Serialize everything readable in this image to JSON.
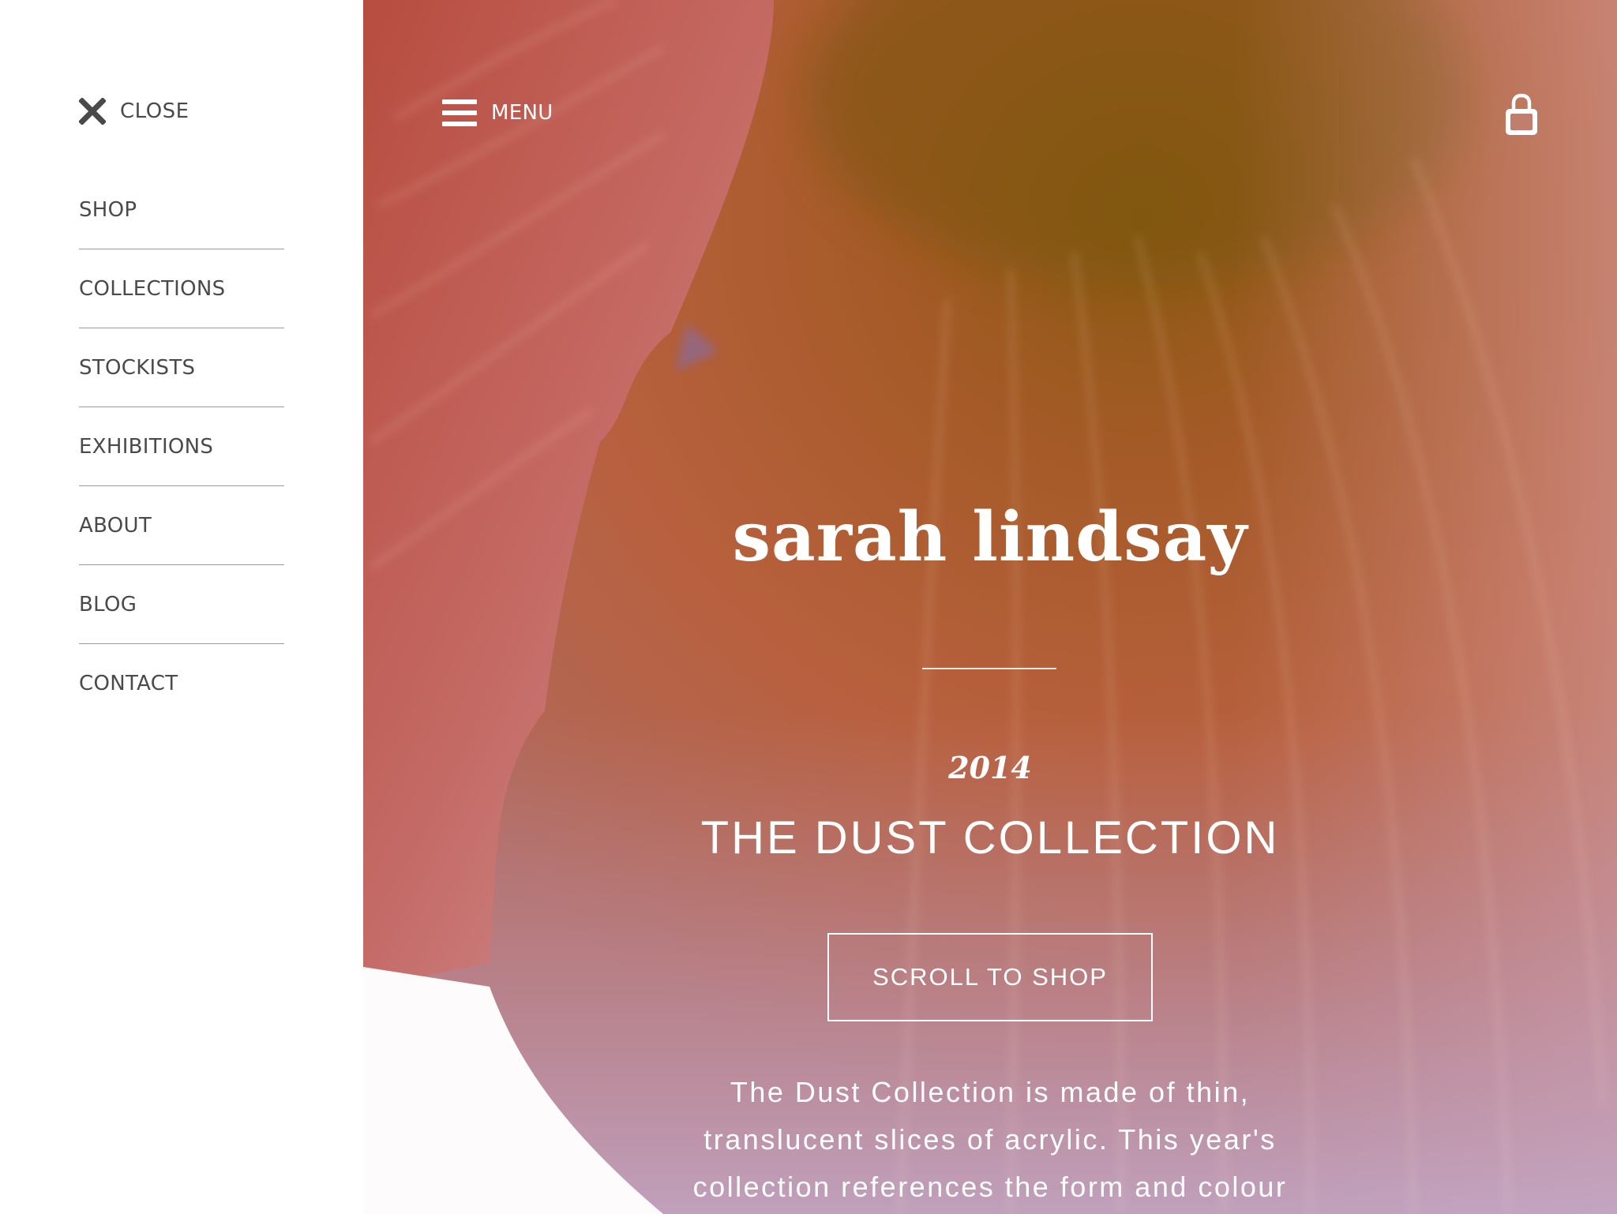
{
  "drawer": {
    "close_label": "CLOSE",
    "close_icon": "close-icon",
    "nav_items": [
      {
        "label": "SHOP"
      },
      {
        "label": "COLLECTIONS"
      },
      {
        "label": "STOCKISTS"
      },
      {
        "label": "EXHIBITIONS"
      },
      {
        "label": "ABOUT"
      },
      {
        "label": "BLOG"
      },
      {
        "label": "CONTACT"
      }
    ]
  },
  "header": {
    "menu_label": "MENU",
    "menu_icon": "hamburger-icon",
    "cart_icon": "shopping-bag-icon"
  },
  "hero": {
    "brand": "sarah lindsay",
    "year": "2014",
    "collection_title": "THE DUST COLLECTION",
    "cta_label": "SCROLL TO SHOP",
    "description_lines": [
      "The Dust Collection is made of thin,",
      "translucent slices of acrylic. This year's",
      "collection references the form and colour"
    ]
  },
  "colors": {
    "text_dark": "#4a4a4a",
    "divider": "#9a9a9a",
    "hero_text": "#ffffff",
    "petal_red": "#c25a4a",
    "petal_orange": "#b0602a",
    "petal_pink": "#c98a8c"
  }
}
